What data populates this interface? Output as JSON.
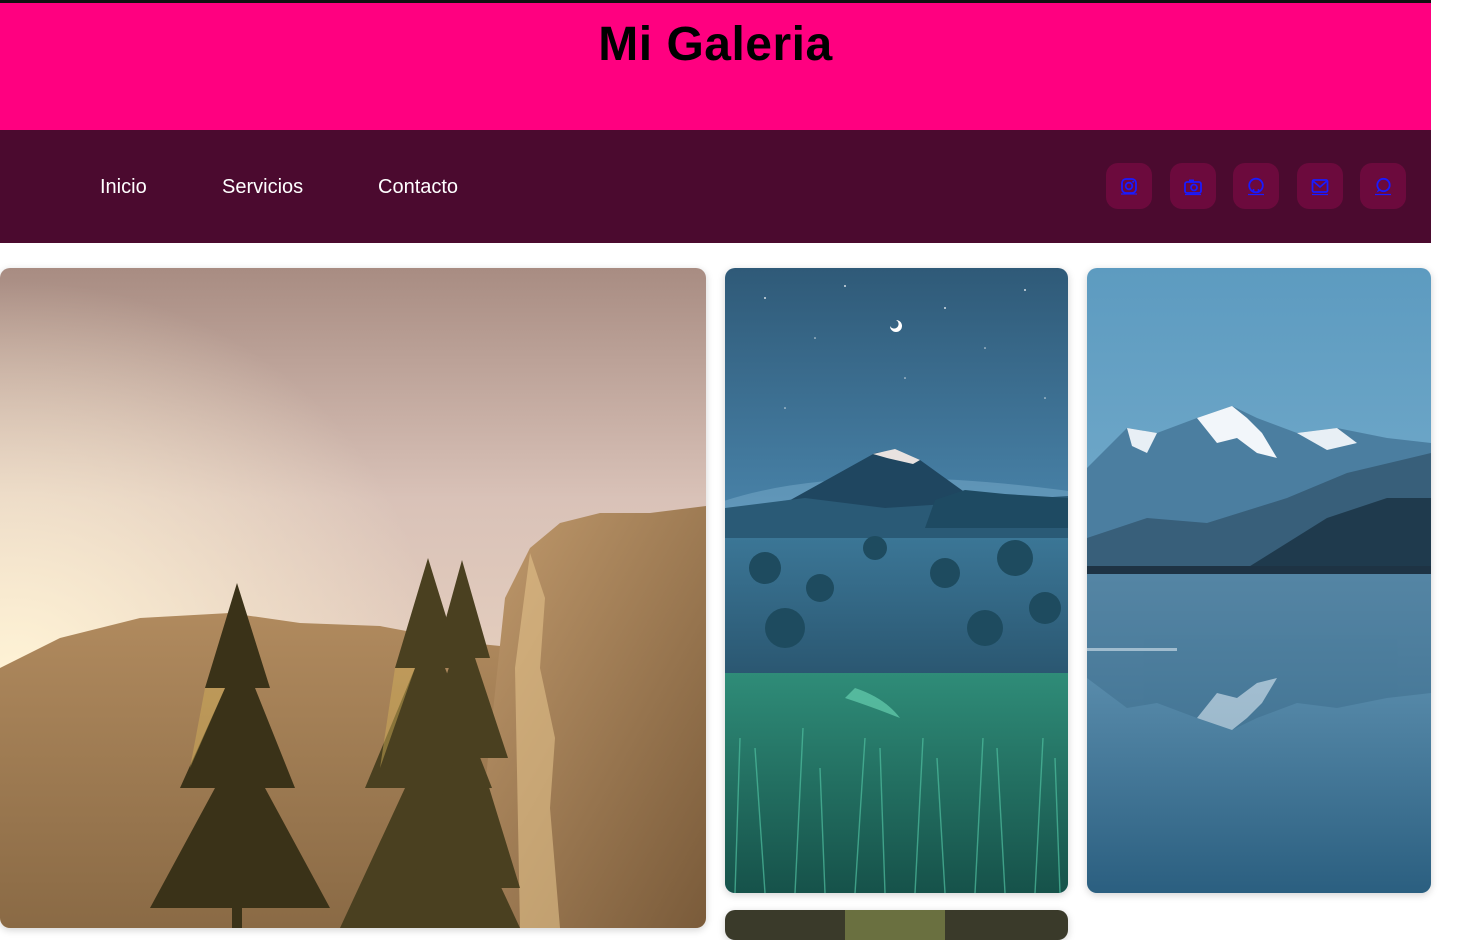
{
  "header": {
    "title": "Mi Galeria"
  },
  "nav": {
    "links": [
      {
        "label": "Inicio"
      },
      {
        "label": "Servicios"
      },
      {
        "label": "Contacto"
      }
    ],
    "social": [
      {
        "icon": "instagram-icon"
      },
      {
        "icon": "camera-icon"
      },
      {
        "icon": "github-icon"
      },
      {
        "icon": "mail-icon"
      },
      {
        "icon": "whatsapp-icon"
      }
    ]
  },
  "colors": {
    "banner": "#ff0080",
    "nav_background": "#4b0a2f",
    "social_button": "#6c0a3d",
    "social_icon": "#1a1aff"
  },
  "gallery": [
    {
      "subject": "sunlit cliffs with pine trees"
    },
    {
      "subject": "volcano at night over misty valley"
    },
    {
      "subject": "snowy mountains reflected in lake"
    }
  ]
}
